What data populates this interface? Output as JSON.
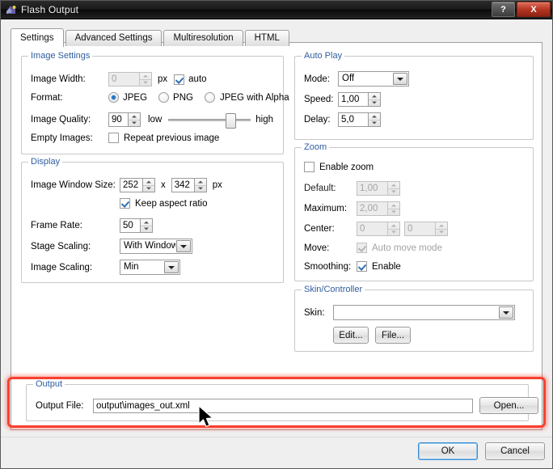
{
  "window": {
    "title": "Flash Output",
    "icon": "app-icon",
    "buttons": {
      "help": "?",
      "close": "X"
    }
  },
  "tabs": [
    {
      "label": "Settings",
      "active": true
    },
    {
      "label": "Advanced Settings",
      "active": false
    },
    {
      "label": "Multiresolution",
      "active": false
    },
    {
      "label": "HTML",
      "active": false
    }
  ],
  "image_settings": {
    "legend": "Image Settings",
    "image_width_label": "Image Width:",
    "image_width_value": "0",
    "px_label": "px",
    "auto_label": "auto",
    "auto_checked": true,
    "format_label": "Format:",
    "format_options": [
      {
        "label": "JPEG",
        "selected": true
      },
      {
        "label": "PNG",
        "selected": false
      },
      {
        "label": "JPEG with Alpha",
        "selected": false
      }
    ],
    "quality_label": "Image Quality:",
    "quality_value": "90",
    "quality_low": "low",
    "quality_high": "high",
    "quality_percent": 90,
    "empty_images_label": "Empty Images:",
    "repeat_previous_label": "Repeat previous image",
    "repeat_previous_checked": false
  },
  "display": {
    "legend": "Display",
    "window_size_label": "Image Window Size:",
    "window_width": "252",
    "size_separator": "x",
    "window_height": "342",
    "px_label": "px",
    "keep_aspect_label": "Keep aspect ratio",
    "keep_aspect_checked": true,
    "frame_rate_label": "Frame Rate:",
    "frame_rate_value": "50",
    "stage_scaling_label": "Stage Scaling:",
    "stage_scaling_value": "With Window",
    "image_scaling_label": "Image Scaling:",
    "image_scaling_value": "Min"
  },
  "auto_play": {
    "legend": "Auto Play",
    "mode_label": "Mode:",
    "mode_value": "Off",
    "speed_label": "Speed:",
    "speed_value": "1,00",
    "delay_label": "Delay:",
    "delay_value": "5,0"
  },
  "zoom": {
    "legend": "Zoom",
    "enable_label": "Enable zoom",
    "enable_checked": false,
    "default_label": "Default:",
    "default_value": "1,00",
    "maximum_label": "Maximum:",
    "maximum_value": "2,00",
    "center_label": "Center:",
    "center_x": "0",
    "center_y": "0",
    "move_label": "Move:",
    "auto_move_label": "Auto move mode",
    "auto_move_checked": true,
    "smoothing_label": "Smoothing:",
    "smoothing_enable_label": "Enable",
    "smoothing_checked": true
  },
  "skin": {
    "legend": "Skin/Controller",
    "skin_label": "Skin:",
    "skin_value": "",
    "edit_button": "Edit...",
    "file_button": "File..."
  },
  "output": {
    "legend": "Output",
    "file_label": "Output File:",
    "file_value": "output\\images_out.xml",
    "open_button": "Open...",
    "highlight_color": "#f8402f"
  },
  "footer": {
    "ok_label": "OK",
    "cancel_label": "Cancel"
  }
}
